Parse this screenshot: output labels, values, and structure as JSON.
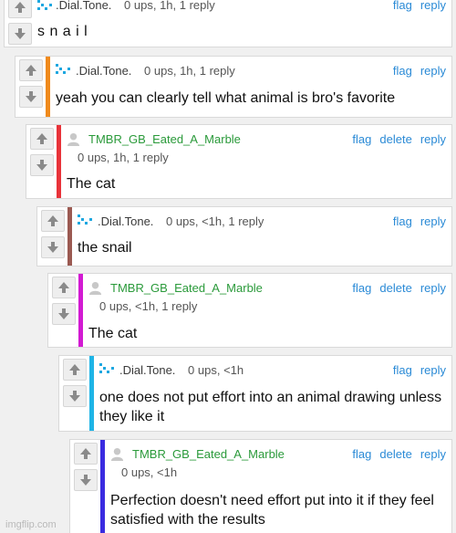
{
  "comments": [
    {
      "user": ".Dial.Tone.",
      "stats": "0 ups, 1h, 1 reply",
      "actions": [
        "flag",
        "reply"
      ],
      "text": "s n a i l",
      "bar_color": ""
    },
    {
      "user": ".Dial.Tone.",
      "stats": "0 ups, 1h, 1 reply",
      "actions": [
        "flag",
        "reply"
      ],
      "text": "yeah you can clearly tell what animal is bro's favorite",
      "bar_color": "#f08a1c"
    },
    {
      "user": "TMBR_GB_Eated_A_Marble",
      "stats": "0 ups, 1h, 1 reply",
      "actions": [
        "flag",
        "delete",
        "reply"
      ],
      "text": "The cat",
      "bar_color": "#e8333a"
    },
    {
      "user": ".Dial.Tone.",
      "stats": "0 ups, <1h, 1 reply",
      "actions": [
        "flag",
        "reply"
      ],
      "text": "the snail",
      "bar_color": "#9b5a52"
    },
    {
      "user": "TMBR_GB_Eated_A_Marble",
      "stats": "0 ups, <1h, 1 reply",
      "actions": [
        "flag",
        "delete",
        "reply"
      ],
      "text": "The cat",
      "bar_color": "#d21ad2"
    },
    {
      "user": ".Dial.Tone.",
      "stats": "0 ups, <1h",
      "actions": [
        "flag",
        "reply"
      ],
      "text": "one does not put effort into an animal drawing unless they like it",
      "bar_color": "#1eb4e6"
    },
    {
      "user": "TMBR_GB_Eated_A_Marble",
      "stats": "0 ups, <1h",
      "actions": [
        "flag",
        "delete",
        "reply"
      ],
      "text": "Perfection doesn't need effort put into it if they feel satisfied with the results",
      "bar_color": "#3a2be0"
    }
  ],
  "watermark": "imgflip.com",
  "colors": {
    "link": "#2a8ad6",
    "username_tmbr": "#2a9a3a",
    "avatar_dial": "#1da7e0"
  },
  "icons": {
    "upvote": "arrow-up-icon",
    "downvote": "arrow-down-icon"
  }
}
